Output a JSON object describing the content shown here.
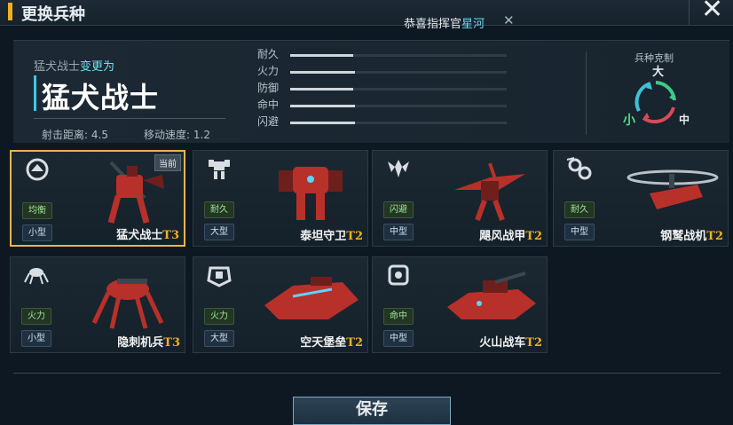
{
  "header": {
    "title": "更换兵种",
    "notice_prefix": "恭喜指挥官",
    "notice_name": "星河",
    "notice_close": "✕",
    "close_glyph": "✕"
  },
  "current": {
    "from_name": "猛犬战士",
    "from_suffix": "变更为",
    "name": "猛犬战士",
    "range_label": "射击距离:",
    "range_value": "4.5",
    "speed_label": "移动速度:",
    "speed_value": "1.2"
  },
  "stats": [
    {
      "label": "耐久",
      "fraction": 0.29
    },
    {
      "label": "火力",
      "fraction": 0.3
    },
    {
      "label": "防御",
      "fraction": 0.29
    },
    {
      "label": "命中",
      "fraction": 0.3
    },
    {
      "label": "闪避",
      "fraction": 0.3
    }
  ],
  "counter": {
    "title": "兵种克制",
    "big": "大",
    "small": "小",
    "mid": "中"
  },
  "units": [
    {
      "name": "猛犬战士",
      "tier": "T3",
      "role": "均衡",
      "size": "小型",
      "icon": "balanced-shield-icon",
      "selected": true,
      "badge": "当前"
    },
    {
      "name": "泰坦守卫",
      "tier": "T2",
      "role": "耐久",
      "size": "大型",
      "icon": "heavy-mech-icon"
    },
    {
      "name": "飓风战甲",
      "tier": "T2",
      "role": "闪避",
      "size": "中型",
      "icon": "winged-mech-icon"
    },
    {
      "name": "钢鹫战机",
      "tier": "T2",
      "role": "耐久",
      "size": "中型",
      "icon": "rotor-craft-icon"
    },
    {
      "name": "隐刺机兵",
      "tier": "T3",
      "role": "火力",
      "size": "小型",
      "icon": "spider-drone-icon"
    },
    {
      "name": "空天堡垒",
      "tier": "T2",
      "role": "火力",
      "size": "大型",
      "icon": "fortress-tank-icon"
    },
    {
      "name": "火山战车",
      "tier": "T2",
      "role": "命中",
      "size": "中型",
      "icon": "crosshair-tank-icon"
    }
  ],
  "footer": {
    "save_label": "保存"
  },
  "colors": {
    "accent": "#f2b01e",
    "cyan": "#3ec8e8",
    "selected_border": "#e8b54c",
    "unit_red": "#b8302a"
  }
}
